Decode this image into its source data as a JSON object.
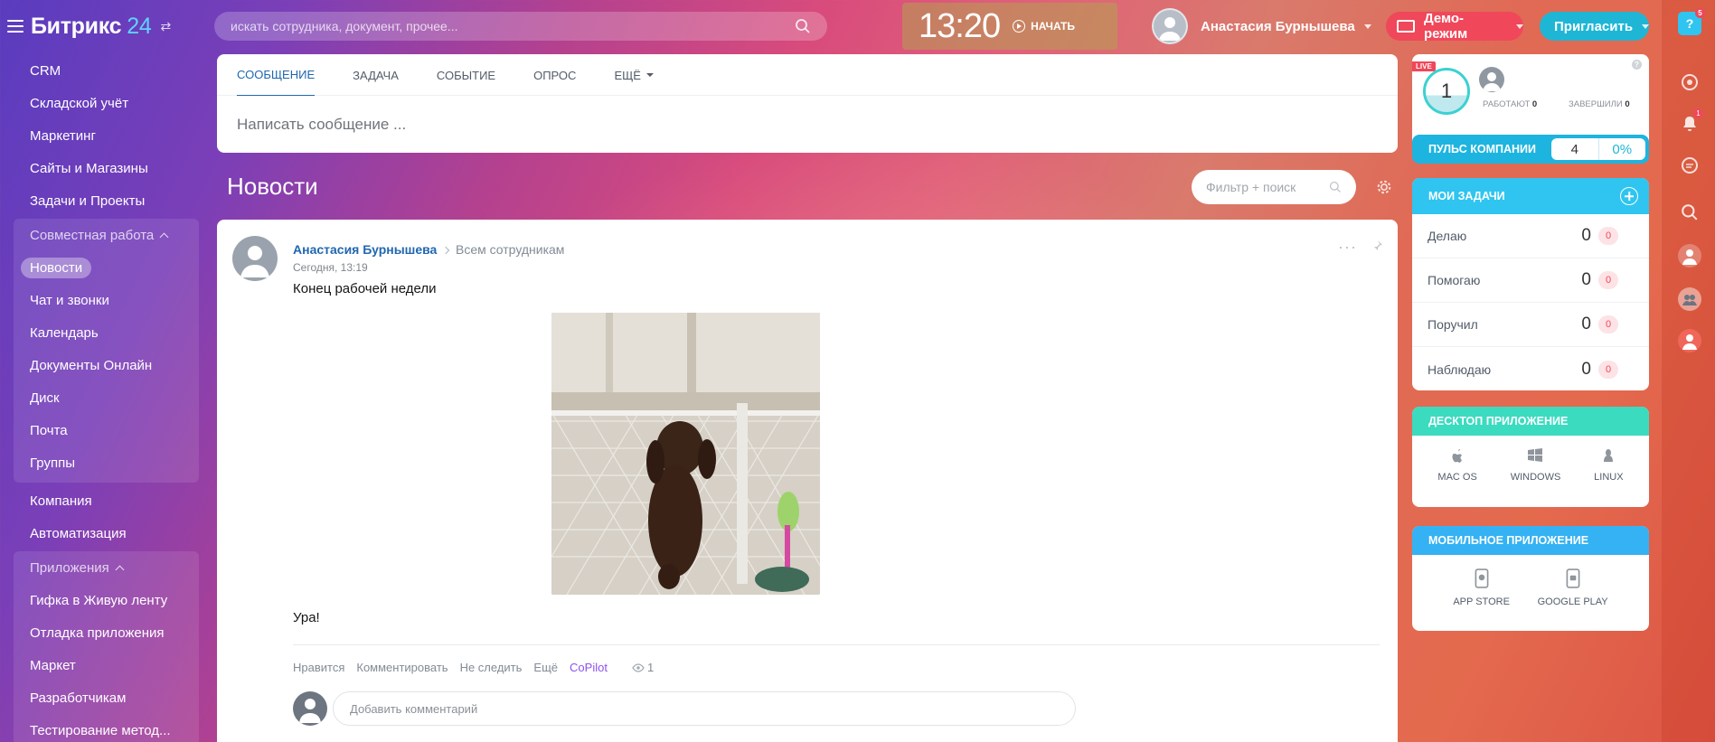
{
  "brand": {
    "name": "Битрикс",
    "num": "24"
  },
  "search": {
    "placeholder": "искать сотрудника, документ, прочее..."
  },
  "clock": {
    "time": "13:20",
    "start_label": "НАЧАТЬ"
  },
  "user": {
    "name": "Анастасия Бурнышева"
  },
  "demo": {
    "label": "Демо-режим"
  },
  "invite": {
    "label": "Пригласить"
  },
  "menu": {
    "items_top": [
      "CRM",
      "Складской учёт",
      "Маркетинг",
      "Сайты и Магазины",
      "Задачи и Проекты"
    ],
    "group1": {
      "title": "Совместная работа",
      "items": [
        "Новости",
        "Чат и звонки",
        "Календарь",
        "Документы Онлайн",
        "Диск",
        "Почта",
        "Группы"
      ]
    },
    "items_mid": [
      "Компания",
      "Автоматизация"
    ],
    "group2": {
      "title": "Приложения",
      "items": [
        "Гифка в Живую ленту",
        "Отладка приложения",
        "Маркет",
        "Разработчикам",
        "Тестирование метод..."
      ]
    }
  },
  "composer": {
    "tabs": [
      "СООБЩЕНИЕ",
      "ЗАДАЧА",
      "СОБЫТИЕ",
      "ОПРОС",
      "ЕЩЁ"
    ],
    "placeholder": "Написать сообщение ..."
  },
  "news": {
    "title": "Новости",
    "filter_placeholder": "Фильтр + поиск"
  },
  "post": {
    "author": "Анастасия Бурнышева",
    "to": "Всем сотрудникам",
    "date": "Сегодня, 13:19",
    "title": "Конец рабочей недели",
    "text": "Ура!",
    "actions": [
      "Нравится",
      "Комментировать",
      "Не следить",
      "Ещё",
      "CoPilot"
    ],
    "views": "1",
    "comment_placeholder": "Добавить комментарий"
  },
  "live": {
    "badge": "LIVE",
    "count": "1",
    "working_label": "РАБОТАЮТ",
    "working": "0",
    "done_label": "ЗАВЕРШИЛИ",
    "done": "0",
    "help": "?"
  },
  "pulse": {
    "label": "ПУЛЬС КОМПАНИИ",
    "value": "4",
    "percent": "0%"
  },
  "tasks": {
    "title": "МОИ ЗАДАЧИ",
    "rows": [
      {
        "label": "Делаю",
        "count": "0",
        "overdue": "0"
      },
      {
        "label": "Помогаю",
        "count": "0",
        "overdue": "0"
      },
      {
        "label": "Поручил",
        "count": "0",
        "overdue": "0"
      },
      {
        "label": "Наблюдаю",
        "count": "0",
        "overdue": "0"
      }
    ]
  },
  "desktop": {
    "title": "ДЕСКТОП ПРИЛОЖЕНИЕ",
    "apps": [
      "MAC OS",
      "WINDOWS",
      "LINUX"
    ]
  },
  "mobile": {
    "title": "МОБИЛЬНОЕ ПРИЛОЖЕНИЕ",
    "apps": [
      "APP STORE",
      "GOOGLE PLAY"
    ]
  },
  "strip": {
    "help": "?",
    "help_count": "5",
    "notif_count": "1"
  },
  "colors": {
    "accent": "#2fc5f0",
    "link": "#2067b0",
    "danger": "#f0475a",
    "copilot": "#8e52ec"
  }
}
